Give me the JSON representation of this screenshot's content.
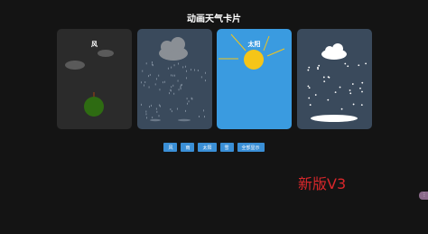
{
  "page": {
    "title": "动画天气卡片"
  },
  "cards": [
    {
      "label": "风",
      "background": "#2b2b2b"
    },
    {
      "label": "",
      "background": "#3a4a5c"
    },
    {
      "label": "太阳",
      "background": "#3a9be0"
    },
    {
      "label": "",
      "background": "#3a4a5c"
    }
  ],
  "buttons": [
    {
      "label": "风"
    },
    {
      "label": "雨"
    },
    {
      "label": "太阳"
    },
    {
      "label": "雪"
    },
    {
      "label": "全部显示"
    }
  ],
  "version_label": "新版V3",
  "colors": {
    "button": "#3a8fd6",
    "sun": "#f5c518",
    "accent_red": "#d8272b"
  },
  "icons": {
    "wind_card": [
      "cloud-icon",
      "tree-icon"
    ],
    "rain_card": [
      "cloud-icon",
      "raindrop-icon"
    ],
    "sun_card": [
      "sun-icon"
    ],
    "snow_card": [
      "cloud-icon",
      "snowflake-icon"
    ]
  }
}
